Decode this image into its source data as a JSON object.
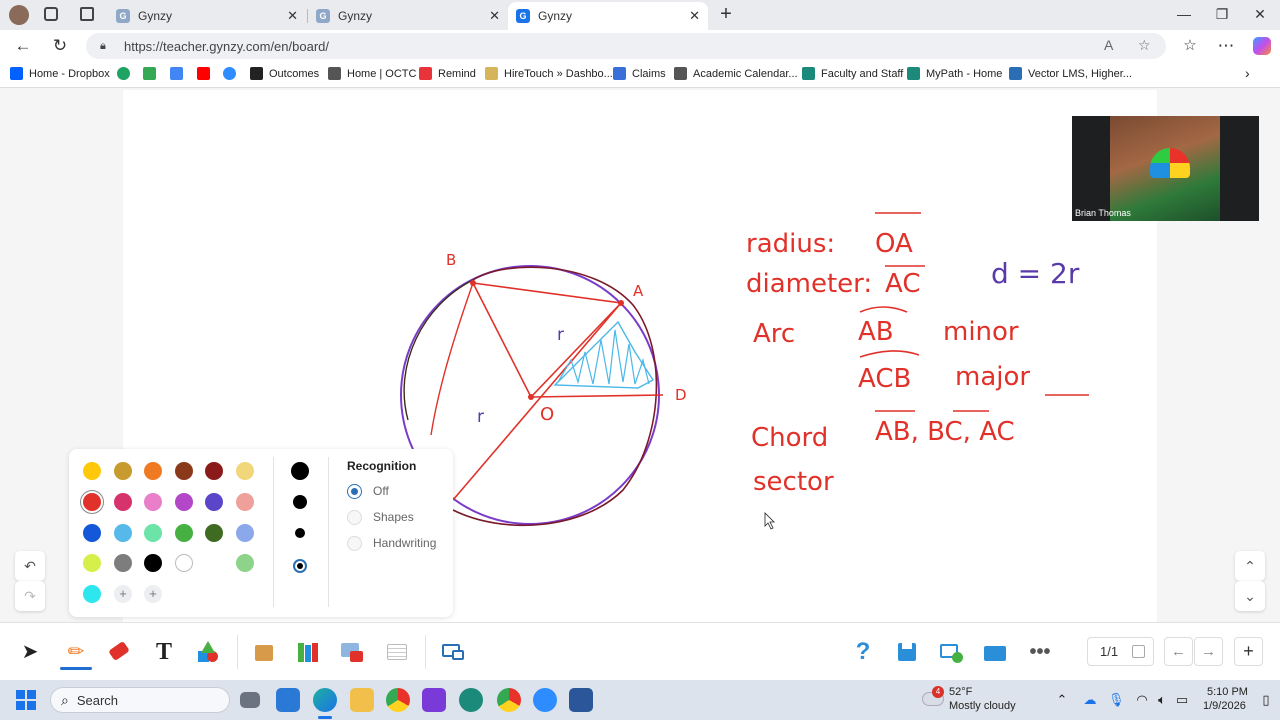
{
  "browser": {
    "tabs": [
      {
        "title": "Gynzy",
        "favicon": "G",
        "active": false
      },
      {
        "title": "Gynzy",
        "favicon": "G",
        "active": false
      },
      {
        "title": "Gynzy",
        "favicon": "G",
        "active": true
      }
    ],
    "new_tab_label": "+",
    "url": "https://teacher.gynzy.com/en/board/",
    "bookmarks": [
      {
        "label": "Home - Dropbox",
        "color": "#0061fe"
      },
      {
        "label": "",
        "color": "#1ea362"
      },
      {
        "label": "",
        "color": "#34a853"
      },
      {
        "label": "",
        "color": "#4285f4"
      },
      {
        "label": "",
        "color": "#ff0000"
      },
      {
        "label": "",
        "color": "#2d8cff"
      },
      {
        "label": "Outcomes",
        "color": "#222222"
      },
      {
        "label": "Home | OCTC",
        "color": "#555555"
      },
      {
        "label": "Remind",
        "color": "#e8333a"
      },
      {
        "label": "HireTouch » Dashbo...",
        "color": "#d6b45a"
      },
      {
        "label": "Claims",
        "color": "#3a6fd8"
      },
      {
        "label": "Academic Calendar...",
        "color": "#555555"
      },
      {
        "label": "Faculty and Staff",
        "color": "#1b8a7a"
      },
      {
        "label": "MyPath - Home",
        "color": "#1b8a7a"
      },
      {
        "label": "Vector LMS, Higher...",
        "color": "#2a6fb5"
      }
    ]
  },
  "board": {
    "notes": {
      "radius": "radius:",
      "radius_value": "OA",
      "diameter": "diameter:",
      "diameter_value": "AC",
      "formula": "d = 2r",
      "arc": "Arc",
      "arc_minor_name": "AB",
      "arc_minor": "minor",
      "arc_major_name": "ACB",
      "arc_major": "major",
      "chord": "Chord",
      "chord_values": "AB, BC, AC",
      "sector": "sector"
    },
    "figure_labels": {
      "point_b": "B",
      "point_a": "A",
      "point_o": "O",
      "point_d": "D",
      "radius_1": "r",
      "radius_2": "r"
    }
  },
  "video": {
    "participant_name": "Brian Thomas"
  },
  "pen_panel": {
    "colors": [
      [
        "#ffc80a",
        "#c89b2e",
        "#f07a22",
        "#8a3a1a",
        "#8b1a1a",
        "#f2d77a"
      ],
      [
        "#e0322a",
        "#d6336c",
        "#ea7fc9",
        "#b347c8",
        "#5b45c8",
        "#f0a09a"
      ],
      [
        "#1457d9",
        "#56b9ea",
        "#6ce3a7",
        "#47b043",
        "#3e6b21",
        "#8aa8ea"
      ],
      [
        "#d7ef4a",
        "#7d7d7d",
        "#000000",
        "#ffffff",
        "",
        "#8ed38a"
      ],
      [
        "#2ee6ee"
      ]
    ],
    "selected_color": "#e0322a",
    "add_label": "+",
    "recognition_title": "Recognition",
    "recognition_options": [
      "Off",
      "Shapes",
      "Handwriting"
    ],
    "recognition_selected": "Off"
  },
  "toolbar": {
    "page_indicator": "1/1"
  },
  "taskbar": {
    "search_placeholder": "Search",
    "weather_badge": "4",
    "temperature": "52°F",
    "weather_text": "Mostly cloudy",
    "time": "5:10 PM",
    "date": "1/9/2026"
  }
}
